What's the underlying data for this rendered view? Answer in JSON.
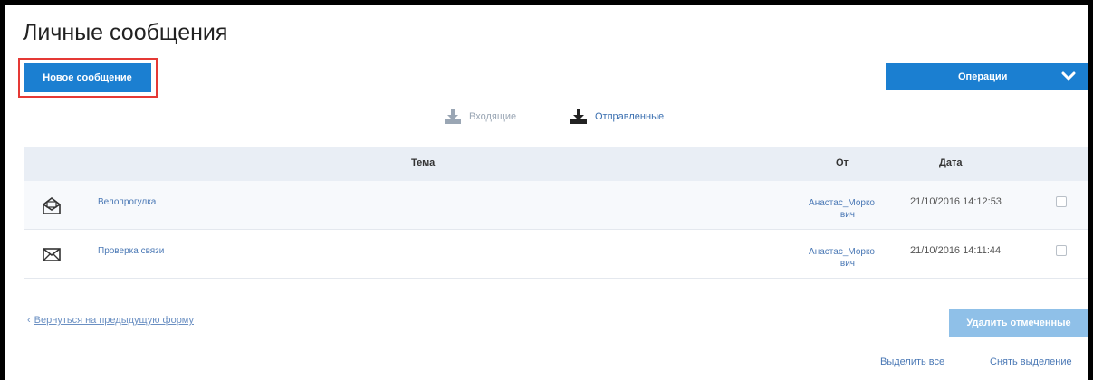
{
  "page": {
    "title": "Личные сообщения"
  },
  "toolbar": {
    "new_message_label": "Новое сообщение",
    "operations_label": "Операции"
  },
  "folders": [
    {
      "label": "Входящие",
      "icon": "inbox-download-icon",
      "active": false
    },
    {
      "label": "Отправленные",
      "icon": "sent-download-icon",
      "active": true
    }
  ],
  "table": {
    "columns": [
      "Тема",
      "От",
      "Дата"
    ],
    "rows": [
      {
        "icon": "envelope-open-icon",
        "subject": "Велопрогулка",
        "from_line1": "Анастас_Морко",
        "from_line2": "вич",
        "date": "21/10/2016 14:12:53"
      },
      {
        "icon": "envelope-closed-icon",
        "subject": "Проверка связи",
        "from_line1": "Анастас_Морко",
        "from_line2": "вич",
        "date": "21/10/2016 14:11:44"
      }
    ]
  },
  "footer": {
    "back_link": "Вернуться на предыдущую форму",
    "delete_label": "Удалить отмеченные",
    "select_all": "Выделить все",
    "deselect": "Снять выделение"
  },
  "colors": {
    "accent": "#1b7fd1",
    "highlight": "#e53935",
    "header_bg": "#e9eef5",
    "link": "#4a78b5"
  }
}
